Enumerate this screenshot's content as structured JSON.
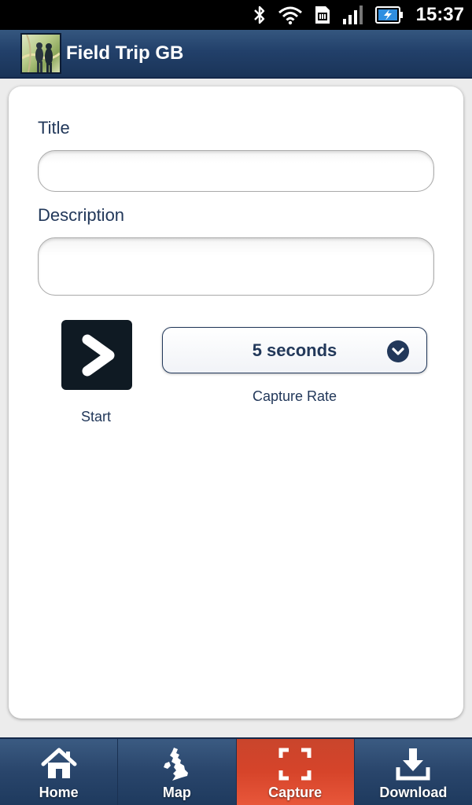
{
  "status_bar": {
    "time": "15:37",
    "icons": [
      "bluetooth-icon",
      "wifi-icon",
      "sim-icon",
      "signal-icon",
      "battery-charging-icon"
    ]
  },
  "header": {
    "title": "Field Trip GB",
    "logo_icon": "app-logo-icon"
  },
  "form": {
    "title_label": "Title",
    "title_value": "",
    "description_label": "Description",
    "description_value": "",
    "start_label": "Start",
    "start_icon": "chevron-right-icon",
    "capture_rate_value": "5 seconds",
    "capture_rate_label": "Capture Rate",
    "capture_rate_icon": "chevron-down-circle-icon"
  },
  "nav": {
    "items": [
      {
        "label": "Home",
        "icon": "home-icon",
        "active": false
      },
      {
        "label": "Map",
        "icon": "uk-map-icon",
        "active": false
      },
      {
        "label": "Capture",
        "icon": "capture-frame-icon",
        "active": true
      },
      {
        "label": "Download",
        "icon": "download-icon",
        "active": false
      }
    ]
  },
  "colors": {
    "header_blue": "#22406a",
    "label_navy": "#22385a",
    "active_tab_red": "#d6442a",
    "card_white": "#ffffff"
  }
}
